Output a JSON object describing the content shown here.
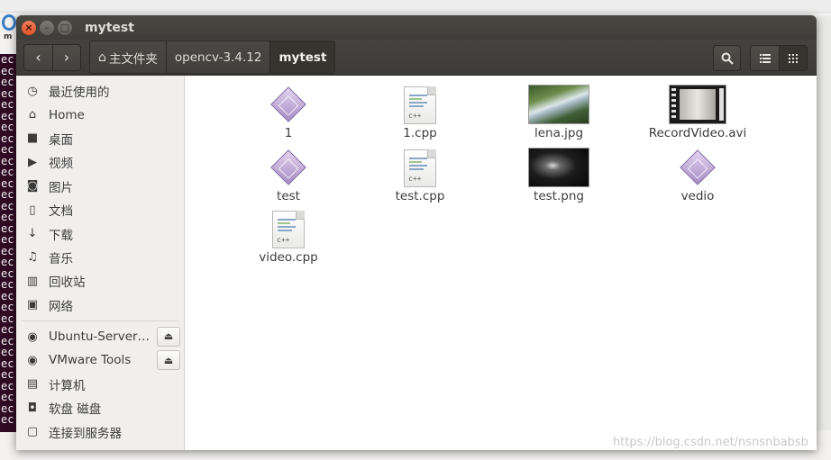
{
  "window": {
    "title": "mytest",
    "controls": {
      "close": "×",
      "minimize": "–",
      "maximize": "□"
    }
  },
  "toolbar": {
    "back": "‹",
    "forward": "›",
    "breadcrumbs": [
      {
        "label": "主文件夹",
        "icon": "home-icon"
      },
      {
        "label": "opencv-3.4.12"
      },
      {
        "label": "mytest",
        "active": true
      }
    ],
    "search_icon": "search-icon",
    "view_list_icon": "list-view-icon",
    "view_grid_icon": "grid-view-icon"
  },
  "sidebar": {
    "items": [
      {
        "label": "最近使用的",
        "icon": "clock-icon"
      },
      {
        "label": "Home",
        "icon": "home-icon"
      },
      {
        "label": "桌面",
        "icon": "folder-icon"
      },
      {
        "label": "视频",
        "icon": "video-icon"
      },
      {
        "label": "图片",
        "icon": "camera-icon"
      },
      {
        "label": "文档",
        "icon": "document-icon"
      },
      {
        "label": "下载",
        "icon": "download-icon"
      },
      {
        "label": "音乐",
        "icon": "music-icon"
      },
      {
        "label": "回收站",
        "icon": "trash-icon"
      },
      {
        "label": "网络",
        "icon": "network-icon"
      }
    ],
    "devices": [
      {
        "label": "Ubuntu-Server…",
        "icon": "disc-icon",
        "eject": true
      },
      {
        "label": "VMware Tools",
        "icon": "disc-icon",
        "eject": true
      },
      {
        "label": "计算机",
        "icon": "computer-icon"
      },
      {
        "label": "软盘 磁盘",
        "icon": "floppy-icon"
      },
      {
        "label": "连接到服务器",
        "icon": "server-icon"
      }
    ]
  },
  "files": [
    {
      "name": "1",
      "kind": "executable"
    },
    {
      "name": "1.cpp",
      "kind": "cpp"
    },
    {
      "name": "lena.jpg",
      "kind": "image-lena"
    },
    {
      "name": "RecordVideo.avi",
      "kind": "video"
    },
    {
      "name": "test",
      "kind": "executable"
    },
    {
      "name": "test.cpp",
      "kind": "cpp"
    },
    {
      "name": "test.png",
      "kind": "image-dark"
    },
    {
      "name": "vedio",
      "kind": "executable"
    },
    {
      "name": "video.cpp",
      "kind": "cpp"
    }
  ],
  "cpp_tag": "c++",
  "watermark": "https://blog.csdn.net/nsnsnbabsb",
  "colors": {
    "titlebar": "#3e3d39",
    "accent_close": "#e05428",
    "sidebar_bg": "#f0efee"
  }
}
